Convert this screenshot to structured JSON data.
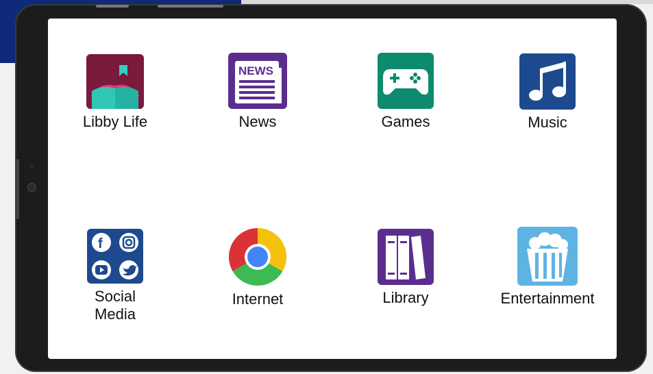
{
  "apps": [
    {
      "label": "Libby Life",
      "icon": "libby-book-icon",
      "color": "#7a1a3c"
    },
    {
      "label": "News",
      "icon": "newspaper-icon",
      "color": "#5b2e8e"
    },
    {
      "label": "Games",
      "icon": "gamepad-icon",
      "color": "#0e8a6e"
    },
    {
      "label": "Music",
      "icon": "music-note-icon",
      "color": "#1d4a8f"
    },
    {
      "label": "Social\nMedia",
      "icon": "social-media-icon",
      "color": "#1d4a8f"
    },
    {
      "label": "Internet",
      "icon": "chrome-icon",
      "color": "#db4437"
    },
    {
      "label": "Library",
      "icon": "library-books-icon",
      "color": "#5b2e8e"
    },
    {
      "label": "Entertainment",
      "icon": "popcorn-icon",
      "color": "#5fb3e3"
    }
  ],
  "news_icon_text": "NEWS"
}
